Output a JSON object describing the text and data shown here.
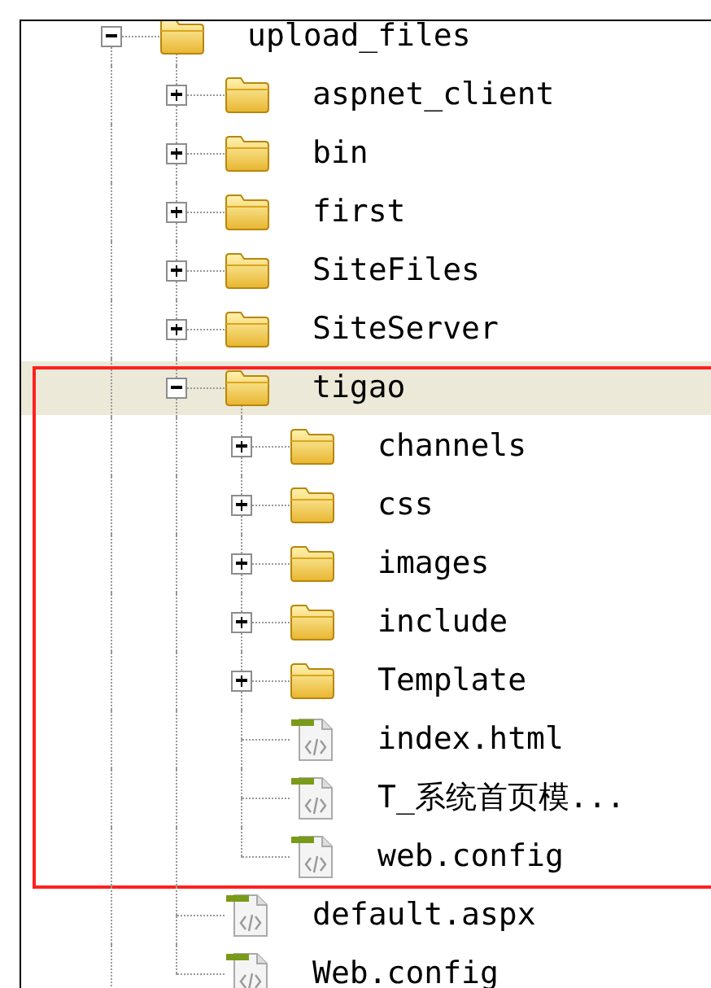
{
  "tree": [
    {
      "label": "upload_files",
      "kind": "folder",
      "expanded": true,
      "selected": false,
      "children": [
        {
          "label": "aspnet_client",
          "kind": "folder",
          "expanded": false,
          "selected": false
        },
        {
          "label": "bin",
          "kind": "folder",
          "expanded": false,
          "selected": false
        },
        {
          "label": "first",
          "kind": "folder",
          "expanded": false,
          "selected": false
        },
        {
          "label": "SiteFiles",
          "kind": "folder",
          "expanded": false,
          "selected": false
        },
        {
          "label": "SiteServer",
          "kind": "folder",
          "expanded": false,
          "selected": false
        },
        {
          "label": "tigao",
          "kind": "folder",
          "expanded": true,
          "selected": true,
          "outlined": true,
          "children": [
            {
              "label": "channels",
              "kind": "folder",
              "expanded": false,
              "selected": false
            },
            {
              "label": "css",
              "kind": "folder",
              "expanded": false,
              "selected": false
            },
            {
              "label": "images",
              "kind": "folder",
              "expanded": false,
              "selected": false
            },
            {
              "label": "include",
              "kind": "folder",
              "expanded": false,
              "selected": false
            },
            {
              "label": "Template",
              "kind": "folder",
              "expanded": false,
              "selected": false
            },
            {
              "label": "index.html",
              "kind": "file",
              "selected": false
            },
            {
              "label": "T_系统首页模...",
              "kind": "file",
              "selected": false
            },
            {
              "label": "web.config",
              "kind": "file",
              "selected": false
            }
          ]
        },
        {
          "label": "default.aspx",
          "kind": "file",
          "selected": false
        },
        {
          "label": "Web.config",
          "kind": "file",
          "selected": false
        }
      ]
    }
  ]
}
